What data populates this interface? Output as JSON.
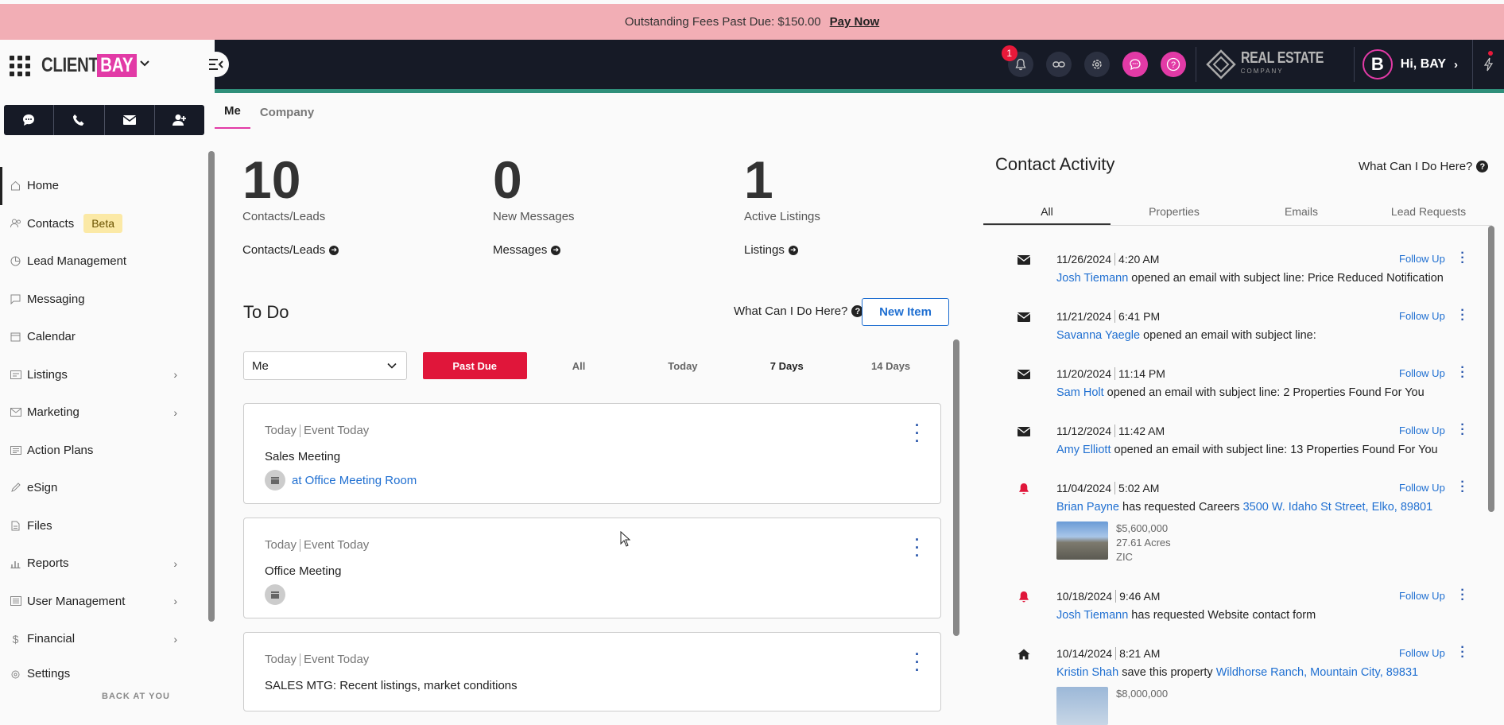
{
  "banner": {
    "text": "Outstanding Fees Past Due: $150.00",
    "link": "Pay Now"
  },
  "brand": {
    "client": "CLIENT",
    "bay": "BAY"
  },
  "topbar": {
    "notification_count": "1",
    "real_estate": "REAL ESTATE",
    "company": "COMPANY",
    "avatar_letter": "B",
    "greeting": "Hi, BAY"
  },
  "sidebar": {
    "items": [
      {
        "label": "Home"
      },
      {
        "label": "Contacts",
        "badge": "Beta"
      },
      {
        "label": "Lead Management"
      },
      {
        "label": "Messaging"
      },
      {
        "label": "Calendar"
      },
      {
        "label": "Listings"
      },
      {
        "label": "Marketing"
      },
      {
        "label": "Action Plans"
      },
      {
        "label": "eSign"
      },
      {
        "label": "Files"
      },
      {
        "label": "Reports"
      },
      {
        "label": "User Management"
      },
      {
        "label": "Financial"
      },
      {
        "label": "Settings"
      }
    ],
    "footer": "BACK AT YOU"
  },
  "tabs": [
    "Me",
    "Company"
  ],
  "stats": [
    {
      "num": "10",
      "label": "Contacts/Leads",
      "link": "Contacts/Leads"
    },
    {
      "num": "0",
      "label": "New Messages",
      "link": "Messages"
    },
    {
      "num": "1",
      "label": "Active Listings",
      "link": "Listings"
    }
  ],
  "todo": {
    "title": "To Do",
    "help": "What Can I Do Here?",
    "new_item": "New Item",
    "select_value": "Me",
    "filters": [
      "Past Due",
      "All",
      "Today",
      "7 Days",
      "14 Days"
    ],
    "cards": [
      {
        "when": "Today",
        "type": "Event Today",
        "title": "Sales Meeting",
        "location": "at Office Meeting Room"
      },
      {
        "when": "Today",
        "type": "Event Today",
        "title": "Office Meeting",
        "location": ""
      },
      {
        "when": "Today",
        "type": "Event Today",
        "title": "SALES MTG: Recent listings, market conditions",
        "location": ""
      }
    ]
  },
  "activity": {
    "title": "Contact Activity",
    "help": "What Can I Do Here?",
    "tabs": [
      "All",
      "Properties",
      "Emails",
      "Lead Requests"
    ],
    "follow_up": "Follow Up",
    "items": [
      {
        "icon": "envelope-icon",
        "date": "11/26/2024",
        "time": "4:20 AM",
        "name": "Josh Tiemann",
        "text": " opened an email with subject line: Price Reduced Notification",
        "link": ""
      },
      {
        "icon": "envelope-icon",
        "date": "11/21/2024",
        "time": "6:41 PM",
        "name": "Savanna Yaegle",
        "text": " opened an email with subject line:",
        "link": ""
      },
      {
        "icon": "envelope-icon",
        "date": "11/20/2024",
        "time": "11:14 PM",
        "name": "Sam Holt",
        "text": " opened an email with subject line: 2 Properties Found For You",
        "link": ""
      },
      {
        "icon": "envelope-icon",
        "date": "11/12/2024",
        "time": "11:42 AM",
        "name": "Amy Elliott",
        "text": " opened an email with subject line: 13 Properties Found For You",
        "link": ""
      },
      {
        "icon": "bell-icon",
        "date": "11/04/2024",
        "time": "5:02 AM",
        "name": "Brian Payne",
        "text": " has requested Careers ",
        "link": "3500 W. Idaho St Street, Elko, 89801",
        "price": "$5,600,000",
        "acres": "27.61 Acres",
        "zone": "ZIC"
      },
      {
        "icon": "bell-icon",
        "date": "10/18/2024",
        "time": "9:46 AM",
        "name": "Josh Tiemann",
        "text": " has requested Website contact form",
        "link": ""
      },
      {
        "icon": "home-icon",
        "date": "10/14/2024",
        "time": "8:21 AM",
        "name": "Kristin Shah",
        "text": " save this property ",
        "link": "Wildhorse Ranch, Mountain City, 89831",
        "price": "$8,000,000"
      }
    ]
  }
}
